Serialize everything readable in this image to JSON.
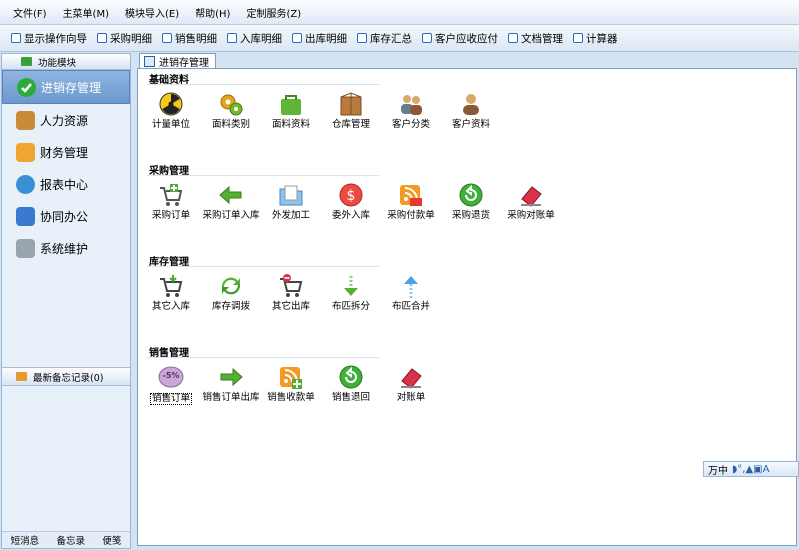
{
  "menubar": [
    "文件(F)",
    "主菜单(M)",
    "模块导入(E)",
    "帮助(H)",
    "定制服务(Z)"
  ],
  "toolbar": [
    "显示操作向导",
    "采购明细",
    "销售明细",
    "入库明细",
    "出库明细",
    "库存汇总",
    "客户应收应付",
    "文档管理",
    "计算器"
  ],
  "sidebar": {
    "header": "功能模块",
    "items": [
      {
        "label": "进销存管理",
        "icon": "check-circle-icon",
        "active": true
      },
      {
        "label": "人力资源",
        "icon": "people-icon"
      },
      {
        "label": "财务管理",
        "icon": "folder-icon"
      },
      {
        "label": "报表中心",
        "icon": "refresh-icon"
      },
      {
        "label": "协同办公",
        "icon": "calendar-icon"
      },
      {
        "label": "系统维护",
        "icon": "lock-icon"
      }
    ],
    "memo_header": "最新备忘记录(0)",
    "bottom_tabs": [
      "短消息",
      "备忘录",
      "便笺"
    ]
  },
  "tab": {
    "label": "进销存管理"
  },
  "sections": [
    {
      "title": "基础资料",
      "items": [
        {
          "label": "计量单位",
          "icon": "radiation-icon"
        },
        {
          "label": "面料类别",
          "icon": "gears-icon"
        },
        {
          "label": "面料资料",
          "icon": "shopping-bag-icon"
        },
        {
          "label": "仓库管理",
          "icon": "box-icon"
        },
        {
          "label": "客户分类",
          "icon": "users-icon"
        },
        {
          "label": "客户资料",
          "icon": "user-icon"
        }
      ]
    },
    {
      "title": "采购管理",
      "items": [
        {
          "label": "采购订单",
          "icon": "cart-add-icon"
        },
        {
          "label": "采购订单入库",
          "icon": "arrow-left-icon"
        },
        {
          "label": "外发加工",
          "icon": "folder-doc-icon"
        },
        {
          "label": "委外入库",
          "icon": "dollar-circle-icon"
        },
        {
          "label": "采购付款单",
          "icon": "rss-icon"
        },
        {
          "label": "采购退货",
          "icon": "return-icon"
        },
        {
          "label": "采购对账单",
          "icon": "eraser-icon"
        }
      ]
    },
    {
      "title": "库存管理",
      "items": [
        {
          "label": "其它入库",
          "icon": "cart-icon"
        },
        {
          "label": "库存调拨",
          "icon": "recycle-icon"
        },
        {
          "label": "其它出库",
          "icon": "cart-remove-icon"
        },
        {
          "label": "布匹拆分",
          "icon": "split-arrow-icon"
        },
        {
          "label": "布匹合并",
          "icon": "merge-arrow-icon"
        }
      ]
    },
    {
      "title": "销售管理",
      "items": [
        {
          "label": "销售订单",
          "icon": "discount-icon",
          "badge": "-5%",
          "selected": true
        },
        {
          "label": "销售订单出库",
          "icon": "arrow-right-icon"
        },
        {
          "label": "销售收款单",
          "icon": "rss-add-icon"
        },
        {
          "label": "销售退回",
          "icon": "return-icon"
        },
        {
          "label": "对账单",
          "icon": "eraser-icon"
        }
      ]
    }
  ],
  "ime": {
    "label": "万中",
    "icon": "ime-toolbar-icon"
  }
}
